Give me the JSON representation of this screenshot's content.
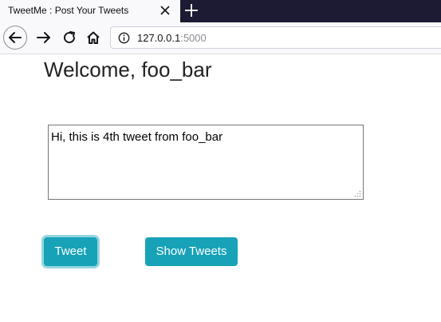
{
  "browser": {
    "tab_title": "TweetMe : Post Your Tweets",
    "url_host": "127.0.0.1",
    "url_port": ":5000",
    "icons": {
      "close": "close-icon",
      "new_tab": "plus-icon",
      "back": "arrow-left-icon",
      "forward": "arrow-right-icon",
      "reload": "reload-icon",
      "home": "home-icon",
      "info": "info-icon"
    }
  },
  "page": {
    "welcome": "Welcome, foo_bar",
    "tweet_value": "Hi, this is 4th tweet from foo_bar",
    "tweet_button": "Tweet",
    "show_button": "Show Tweets",
    "accent_color": "#17a2b8"
  }
}
